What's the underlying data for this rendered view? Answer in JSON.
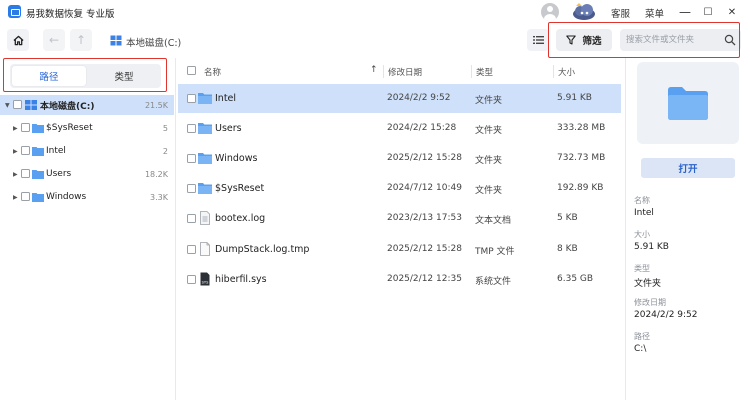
{
  "app": {
    "title": "易我数据恢复 专业版"
  },
  "titlebar": {
    "support_label": "客服",
    "menu_label": "菜单",
    "minimize": "—",
    "maximize": "☐",
    "close": "✕"
  },
  "toolbar": {
    "path": "本地磁盘(C:)",
    "filter_label": "筛选",
    "search_placeholder": "搜索文件或文件夹"
  },
  "sidebar": {
    "tabs": [
      {
        "label": "路径",
        "active": true
      },
      {
        "label": "类型",
        "active": false
      }
    ],
    "tree": [
      {
        "label": "本地磁盘(C:)",
        "count": "21.5K",
        "expanded": true,
        "selected": true
      },
      {
        "label": "$SysReset",
        "count": "5"
      },
      {
        "label": "Intel",
        "count": "2"
      },
      {
        "label": "Users",
        "count": "18.2K"
      },
      {
        "label": "Windows",
        "count": "3.3K"
      }
    ]
  },
  "list": {
    "headers": {
      "name": "名称",
      "modified": "修改日期",
      "type": "类型",
      "size": "大小"
    },
    "sort_indicator": "↑",
    "rows": [
      {
        "name": "Intel",
        "modified": "2024/2/2 9:52",
        "type": "文件夹",
        "size": "5.91 KB",
        "icon": "folder-icon",
        "selected": true
      },
      {
        "name": "Users",
        "modified": "2024/2/2 15:28",
        "type": "文件夹",
        "size": "333.28 MB",
        "icon": "folder-icon"
      },
      {
        "name": "Windows",
        "modified": "2025/2/12 15:28",
        "type": "文件夹",
        "size": "732.73 MB",
        "icon": "folder-icon"
      },
      {
        "name": "$SysReset",
        "modified": "2024/7/12 10:49",
        "type": "文件夹",
        "size": "192.89 KB",
        "icon": "folder-icon"
      },
      {
        "name": "bootex.log",
        "modified": "2023/2/13 17:53",
        "type": "文本文档",
        "size": "5 KB",
        "icon": "text-file-icon"
      },
      {
        "name": "DumpStack.log.tmp",
        "modified": "2025/2/12 15:28",
        "type": "TMP 文件",
        "size": "8 KB",
        "icon": "file-icon"
      },
      {
        "name": "hiberfil.sys",
        "modified": "2025/2/12 12:35",
        "type": "系统文件",
        "size": "6.35 GB",
        "icon": "sys-file-icon"
      }
    ]
  },
  "preview": {
    "open_label": "打开",
    "fields": [
      {
        "label": "名称",
        "value": "Intel"
      },
      {
        "label": "大小",
        "value": "5.91 KB"
      },
      {
        "label": "类型",
        "value": "文件夹"
      },
      {
        "label": "修改日期",
        "value": "2024/2/2 9:52"
      },
      {
        "label": "路径",
        "value": "C:\\"
      }
    ]
  },
  "colors": {
    "accent": "#2563d9",
    "selection": "#cfe0fb",
    "highlight_border": "#e0342f",
    "folder": "#5aa0f0"
  }
}
